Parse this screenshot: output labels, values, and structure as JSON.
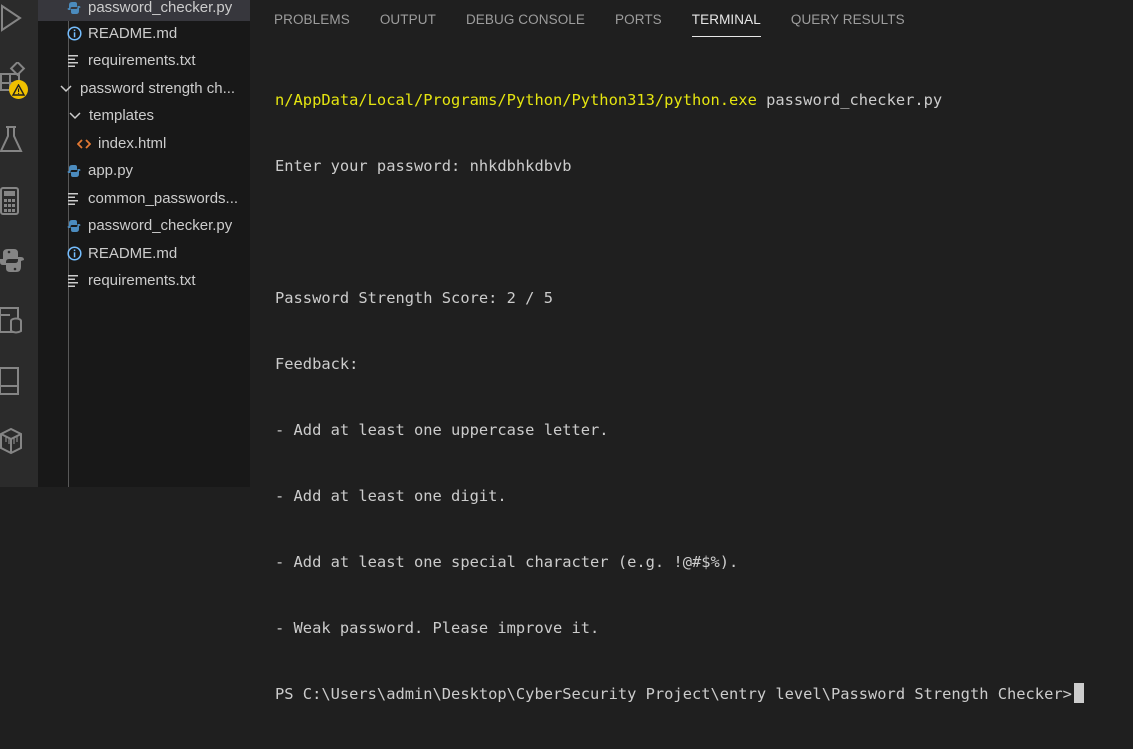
{
  "activity_bar": {
    "icons": [
      "run-debug-icon",
      "extensions-icon",
      "testing-icon",
      "calculator-icon",
      "python-icon",
      "database-icon",
      "panel-icon",
      "package-icon"
    ]
  },
  "explorer": {
    "items": [
      {
        "label": "password_checker.py",
        "icon": "python-file",
        "indent": 1
      },
      {
        "label": "README.md",
        "icon": "info",
        "indent": 1
      },
      {
        "label": "requirements.txt",
        "icon": "lines",
        "indent": 1
      },
      {
        "label": "password strength ch...",
        "icon": "chevron-down",
        "indent": 0
      },
      {
        "label": "templates",
        "icon": "chevron-down",
        "indent": 1
      },
      {
        "label": "index.html",
        "icon": "html",
        "indent": 2
      },
      {
        "label": "app.py",
        "icon": "python-file",
        "indent": 1
      },
      {
        "label": "common_passwords...",
        "icon": "lines",
        "indent": 1
      },
      {
        "label": "password_checker.py",
        "icon": "python-file",
        "indent": 1
      },
      {
        "label": "README.md",
        "icon": "info",
        "indent": 1
      },
      {
        "label": "requirements.txt",
        "icon": "lines",
        "indent": 1
      }
    ]
  },
  "panel": {
    "tabs": [
      {
        "label": "PROBLEMS",
        "active": false
      },
      {
        "label": "OUTPUT",
        "active": false
      },
      {
        "label": "DEBUG CONSOLE",
        "active": false
      },
      {
        "label": "PORTS",
        "active": false
      },
      {
        "label": "TERMINAL",
        "active": true
      },
      {
        "label": "QUERY RESULTS",
        "active": false
      }
    ]
  },
  "terminal": {
    "command_path": "n/AppData/Local/Programs/Python/Python313/python.exe",
    "command_arg": " password_checker.py",
    "lines": [
      "Enter your password: nhkdbhkdbvb",
      "",
      "Password Strength Score: 2 / 5",
      "Feedback:",
      "- Add at least one uppercase letter.",
      "- Add at least one digit.",
      "- Add at least one special character (e.g. !@#$%).",
      "- Weak password. Please improve it."
    ],
    "prompt": "PS C:\\Users\\admin\\Desktop\\CyberSecurity Project\\entry level\\Password Strength Checker>"
  },
  "colors": {
    "accent_yellow": "#e5e510",
    "python_blue": "#4b8bbe",
    "html_orange": "#e37933",
    "info_blue": "#75beff",
    "warning": "#f0c000"
  }
}
